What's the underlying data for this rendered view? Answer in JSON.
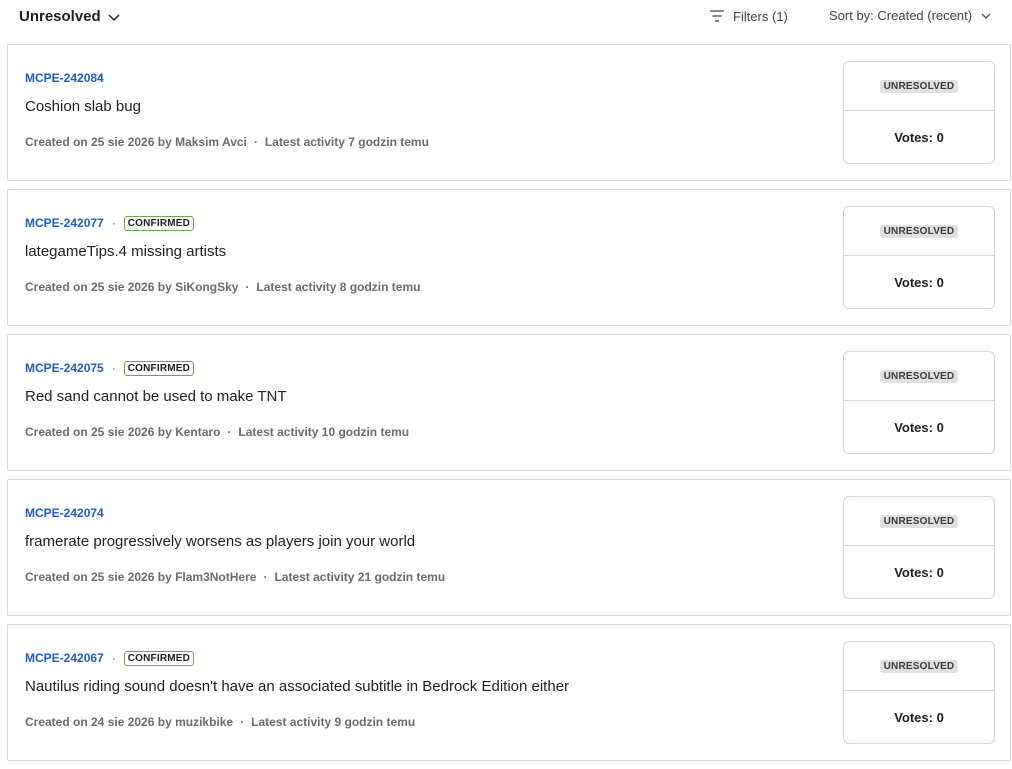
{
  "toolbar": {
    "status_filter_label": "Unresolved",
    "filters_label": "Filters (1)",
    "sort_label": "Sort by: Created (recent)"
  },
  "issues": [
    {
      "key": "MCPE-242084",
      "confirmed": false,
      "confirmed_label": "",
      "title": "Coshion slab bug",
      "created": "Created on 25 sie 2026 by Maksim Avci",
      "activity": "Latest activity 7 godzin temu",
      "status": "UNRESOLVED",
      "votes": "Votes: 0"
    },
    {
      "key": "MCPE-242077",
      "confirmed": true,
      "confirmed_label": "CONFIRMED",
      "title": "lategameTips.4 missing artists",
      "created": "Created on 25 sie 2026 by SiKongSky",
      "activity": "Latest activity 8 godzin temu",
      "status": "UNRESOLVED",
      "votes": "Votes: 0"
    },
    {
      "key": "MCPE-242075",
      "confirmed": true,
      "confirmed_label": "CONFIRMED",
      "title": "Red sand cannot be used to make TNT",
      "created": "Created on 25 sie 2026 by Kentaro",
      "activity": "Latest activity 10 godzin temu",
      "status": "UNRESOLVED",
      "votes": "Votes: 0"
    },
    {
      "key": "MCPE-242074",
      "confirmed": false,
      "confirmed_label": "",
      "title": "framerate progressively worsens as players join your world",
      "created": "Created on 25 sie 2026 by Flam3NotHere",
      "activity": "Latest activity 21 godzin temu",
      "status": "UNRESOLVED",
      "votes": "Votes: 0"
    },
    {
      "key": "MCPE-242067",
      "confirmed": true,
      "confirmed_label": "CONFIRMED",
      "title": "Nautilus riding sound doesn't have an associated subtitle in Bedrock Edition either",
      "created": "Created on 24 sie 2026 by muzikbike",
      "activity": "Latest activity 9 godzin temu",
      "status": "UNRESOLVED",
      "votes": "Votes: 0"
    }
  ],
  "separator": "·",
  "colors": {
    "link": "#1d5fb8",
    "confirmed_border": "#6aa84f",
    "unresolved_bg": "#e0e0e0",
    "border": "#d9d9d9"
  }
}
